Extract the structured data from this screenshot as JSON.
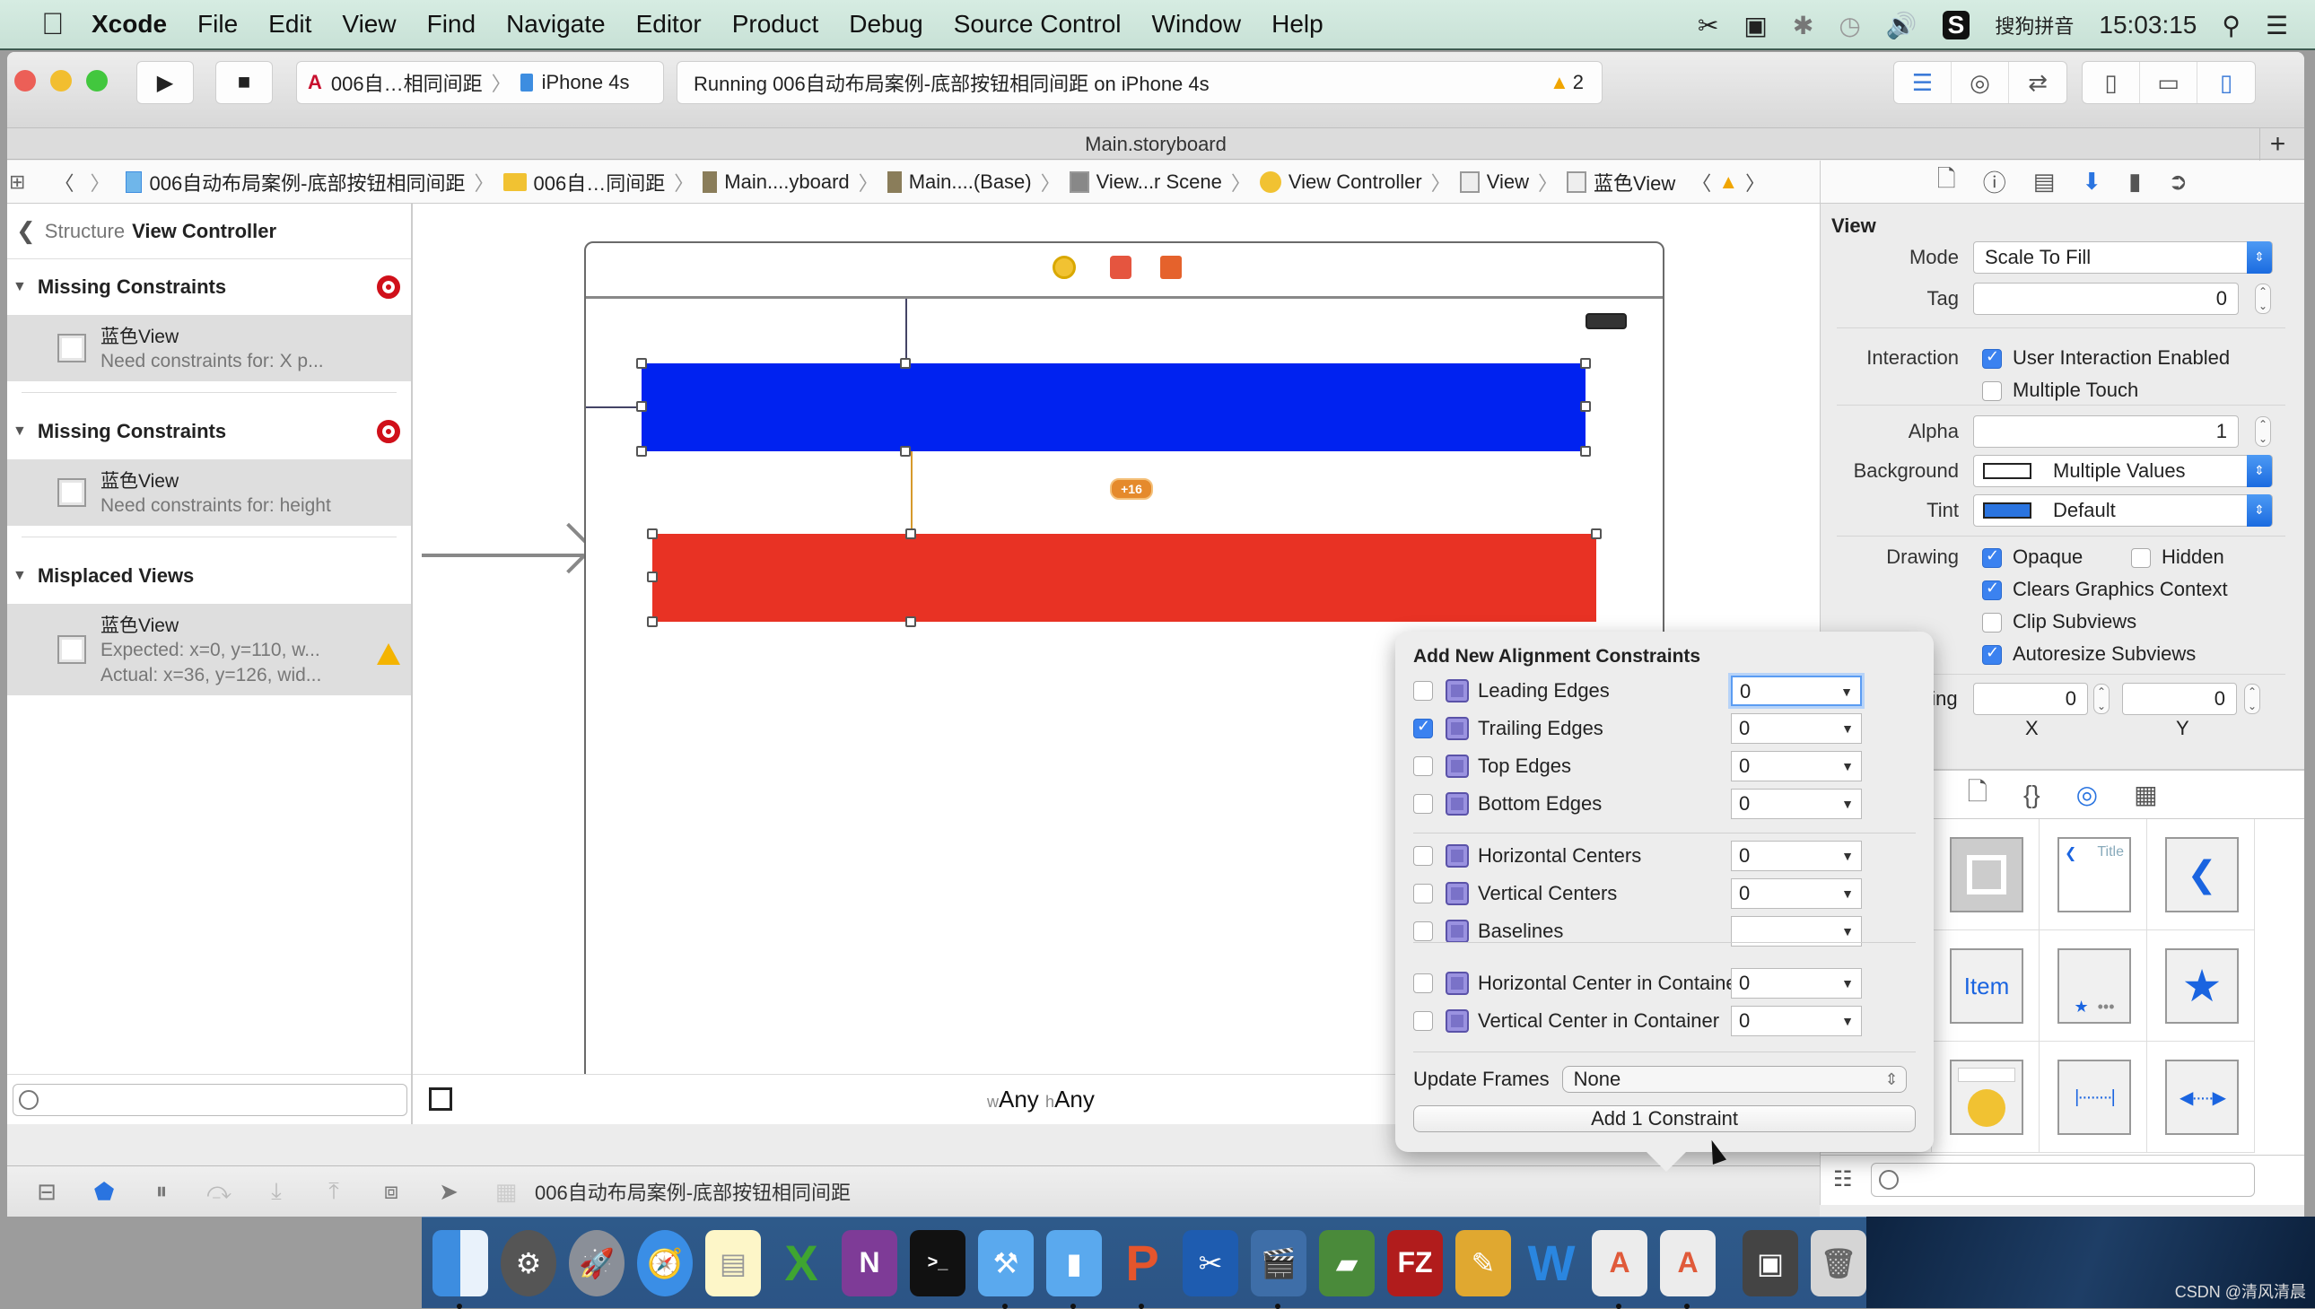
{
  "menubar": {
    "apple": "",
    "app_name": "Xcode",
    "items": [
      "File",
      "Edit",
      "View",
      "Find",
      "Navigate",
      "Editor",
      "Product",
      "Debug",
      "Source Control",
      "Window",
      "Help"
    ],
    "input_method_badge": "S",
    "input_method": "搜狗拼音",
    "clock": "15:03:15"
  },
  "toolbar": {
    "scheme_name": "006自…相同间距",
    "device": "iPhone 4s",
    "status_text": "Running 006自动布局案例-底部按钮相同间距 on iPhone 4s",
    "warning_count": "2"
  },
  "tab": {
    "title": "Main.storyboard",
    "plus": "+"
  },
  "jumpbar": {
    "crumbs": [
      "006自动布局案例-底部按钮相同间距",
      "006自…同间距",
      "Main....yboard",
      "Main....(Base)",
      "View...r Scene",
      "View Controller",
      "View",
      "蓝色View"
    ]
  },
  "navigator": {
    "back_label": "Structure",
    "title": "View Controller",
    "sections": [
      {
        "title": "Missing Constraints",
        "badge": "error",
        "item_title": "蓝色View",
        "item_lines": [
          "Need constraints for: X p..."
        ]
      },
      {
        "title": "Missing Constraints",
        "badge": "error",
        "item_title": "蓝色View",
        "item_lines": [
          "Need constraints for: height"
        ]
      },
      {
        "title": "Misplaced Views",
        "badge": "warning",
        "item_title": "蓝色View",
        "item_lines": [
          "Expected: x=0, y=110, w...",
          "Actual: x=36, y=126, wid..."
        ]
      }
    ]
  },
  "canvas": {
    "spacing_badge": "+16",
    "size_class_w_prefix": "w",
    "size_class_w": "Any",
    "size_class_h_prefix": "h",
    "size_class_h": "Any",
    "colors": {
      "blue_view": "#0022f0",
      "red_view": "#e83224"
    }
  },
  "popover": {
    "title": "Add New Alignment Constraints",
    "rows": [
      {
        "label": "Leading Edges",
        "checked": false,
        "value": "0",
        "focused": true
      },
      {
        "label": "Trailing Edges",
        "checked": true,
        "value": "0"
      },
      {
        "label": "Top Edges",
        "checked": false,
        "value": "0"
      },
      {
        "label": "Bottom Edges",
        "checked": false,
        "value": "0"
      },
      {
        "label": "Horizontal Centers",
        "checked": false,
        "value": "0"
      },
      {
        "label": "Vertical Centers",
        "checked": false,
        "value": "0"
      },
      {
        "label": "Baselines",
        "checked": false,
        "value": ""
      },
      {
        "label": "Horizontal Center in Container",
        "checked": false,
        "value": "0"
      },
      {
        "label": "Vertical Center in Container",
        "checked": false,
        "value": "0"
      }
    ],
    "update_frames_label": "Update Frames",
    "update_frames_value": "None",
    "add_button": "Add 1 Constraint"
  },
  "inspector": {
    "section_title": "View",
    "mode_label": "Mode",
    "mode_value": "Scale To Fill",
    "tag_label": "Tag",
    "tag_value": "0",
    "interaction_label": "Interaction",
    "user_interaction": {
      "label": "User Interaction Enabled",
      "checked": true
    },
    "multiple_touch": {
      "label": "Multiple Touch",
      "checked": false
    },
    "alpha_label": "Alpha",
    "alpha_value": "1",
    "background_label": "Background",
    "background_value": "Multiple Values",
    "tint_label": "Tint",
    "tint_value": "Default",
    "drawing_label": "Drawing",
    "opaque": {
      "label": "Opaque",
      "checked": true
    },
    "hidden": {
      "label": "Hidden",
      "checked": false
    },
    "clears": {
      "label": "Clears Graphics Context",
      "checked": true
    },
    "clip": {
      "label": "Clip Subviews",
      "checked": false
    },
    "autoresize": {
      "label": "Autoresize Subviews",
      "checked": true
    },
    "stretching_label": "ching",
    "stretch_x": "0",
    "stretch_y": "0",
    "x_label": "X",
    "y_label": "Y"
  },
  "library": {
    "items": [
      "view",
      "navigation-bar",
      "back-chevron",
      "Item",
      "toolbar-star",
      "star",
      "search-bar",
      "fixed-space",
      "flexible-space"
    ],
    "nav_title": "Title",
    "item_label": "Item"
  },
  "debugbar": {
    "target": "006自动布局案例-底部按钮相同间距"
  },
  "watermark": "CSDN @清风清晨"
}
